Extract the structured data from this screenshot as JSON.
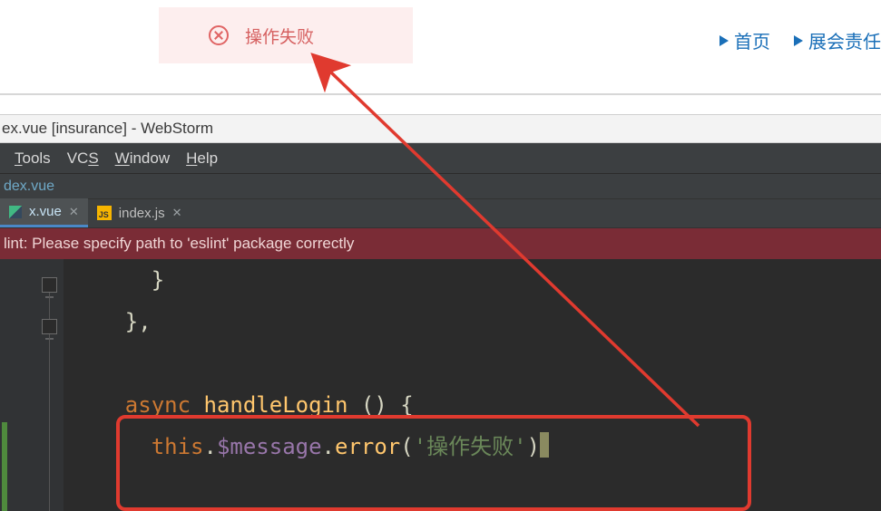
{
  "toast": {
    "message": "操作失败"
  },
  "nav": {
    "home": "首页",
    "liability": "展会责任"
  },
  "ide": {
    "title": "ex.vue [insurance] - WebStorm",
    "menu": {
      "tools": "Tools",
      "vcs": "VCS",
      "window": "Window",
      "help": "Help"
    },
    "breadcrumb": "dex.vue",
    "tabs": {
      "active_name": "x.vue",
      "second_name": "index.js",
      "js_badge": "JS"
    },
    "lint_warning": "lint: Please specify path to 'eslint' package correctly",
    "code": {
      "l1": "      }",
      "l2": "    },",
      "kw_async": "async",
      "fn_name": "handleLogin",
      "fn_sig_rest": " () {",
      "this_kw": "this",
      "dot1": ".",
      "prop1": "$message",
      "dot2": ".",
      "prop2": "error",
      "open_call": "(",
      "str_open": "'",
      "str_text": "操作失败",
      "str_close": "'",
      "close_call": ")"
    }
  }
}
